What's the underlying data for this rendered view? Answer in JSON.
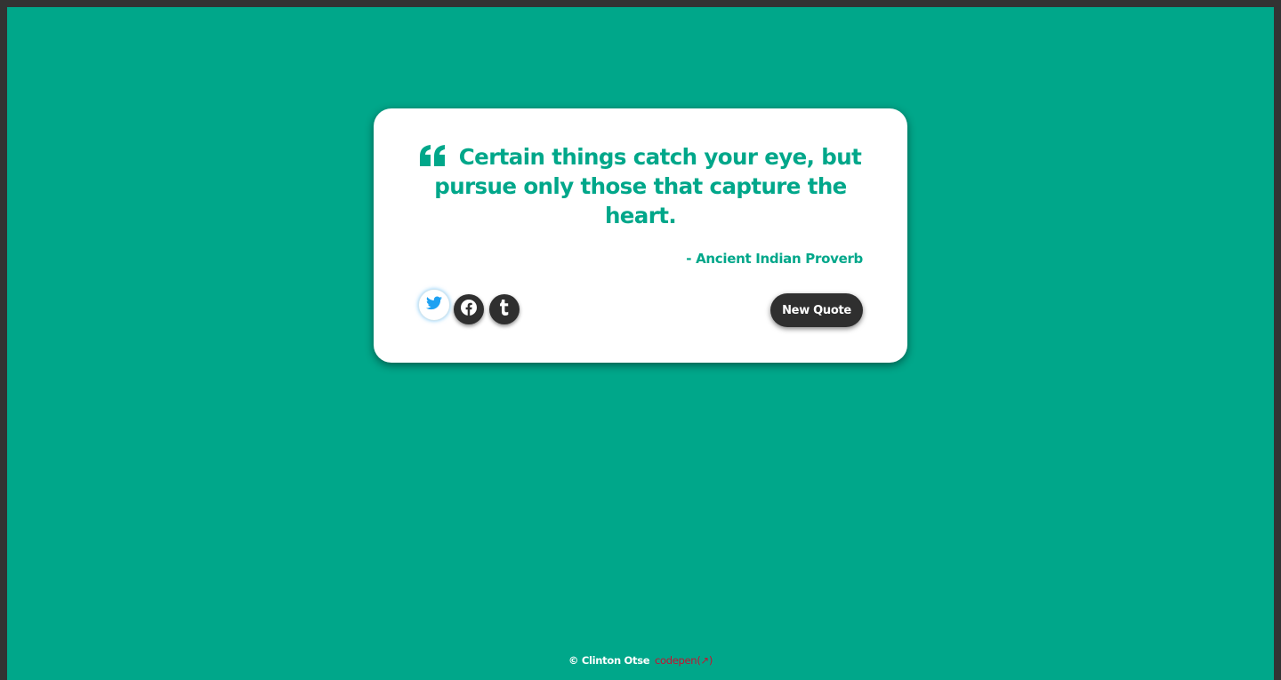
{
  "quote": {
    "text": "Certain things catch your eye, but pursue only those that capture the heart.",
    "author": "- Ancient Indian Proverb",
    "icon": "quote-left-icon"
  },
  "share": [
    {
      "name": "twitter",
      "icon": "twitter-icon",
      "color": "#1da1f2"
    },
    {
      "name": "facebook",
      "icon": "facebook-icon",
      "color": "#2f2f2f"
    },
    {
      "name": "tumblr",
      "icon": "tumblr-icon",
      "color": "#2f2f2f"
    }
  ],
  "actions": {
    "new_quote_label": "New Quote"
  },
  "footer": {
    "credit": "© Clinton Otse",
    "link_label": "codepen",
    "link_suffix": "(↗)"
  },
  "colors": {
    "accent": "#00a78a",
    "dark": "#2f2f2f",
    "card": "#ffffff",
    "link": "#c8102e"
  }
}
